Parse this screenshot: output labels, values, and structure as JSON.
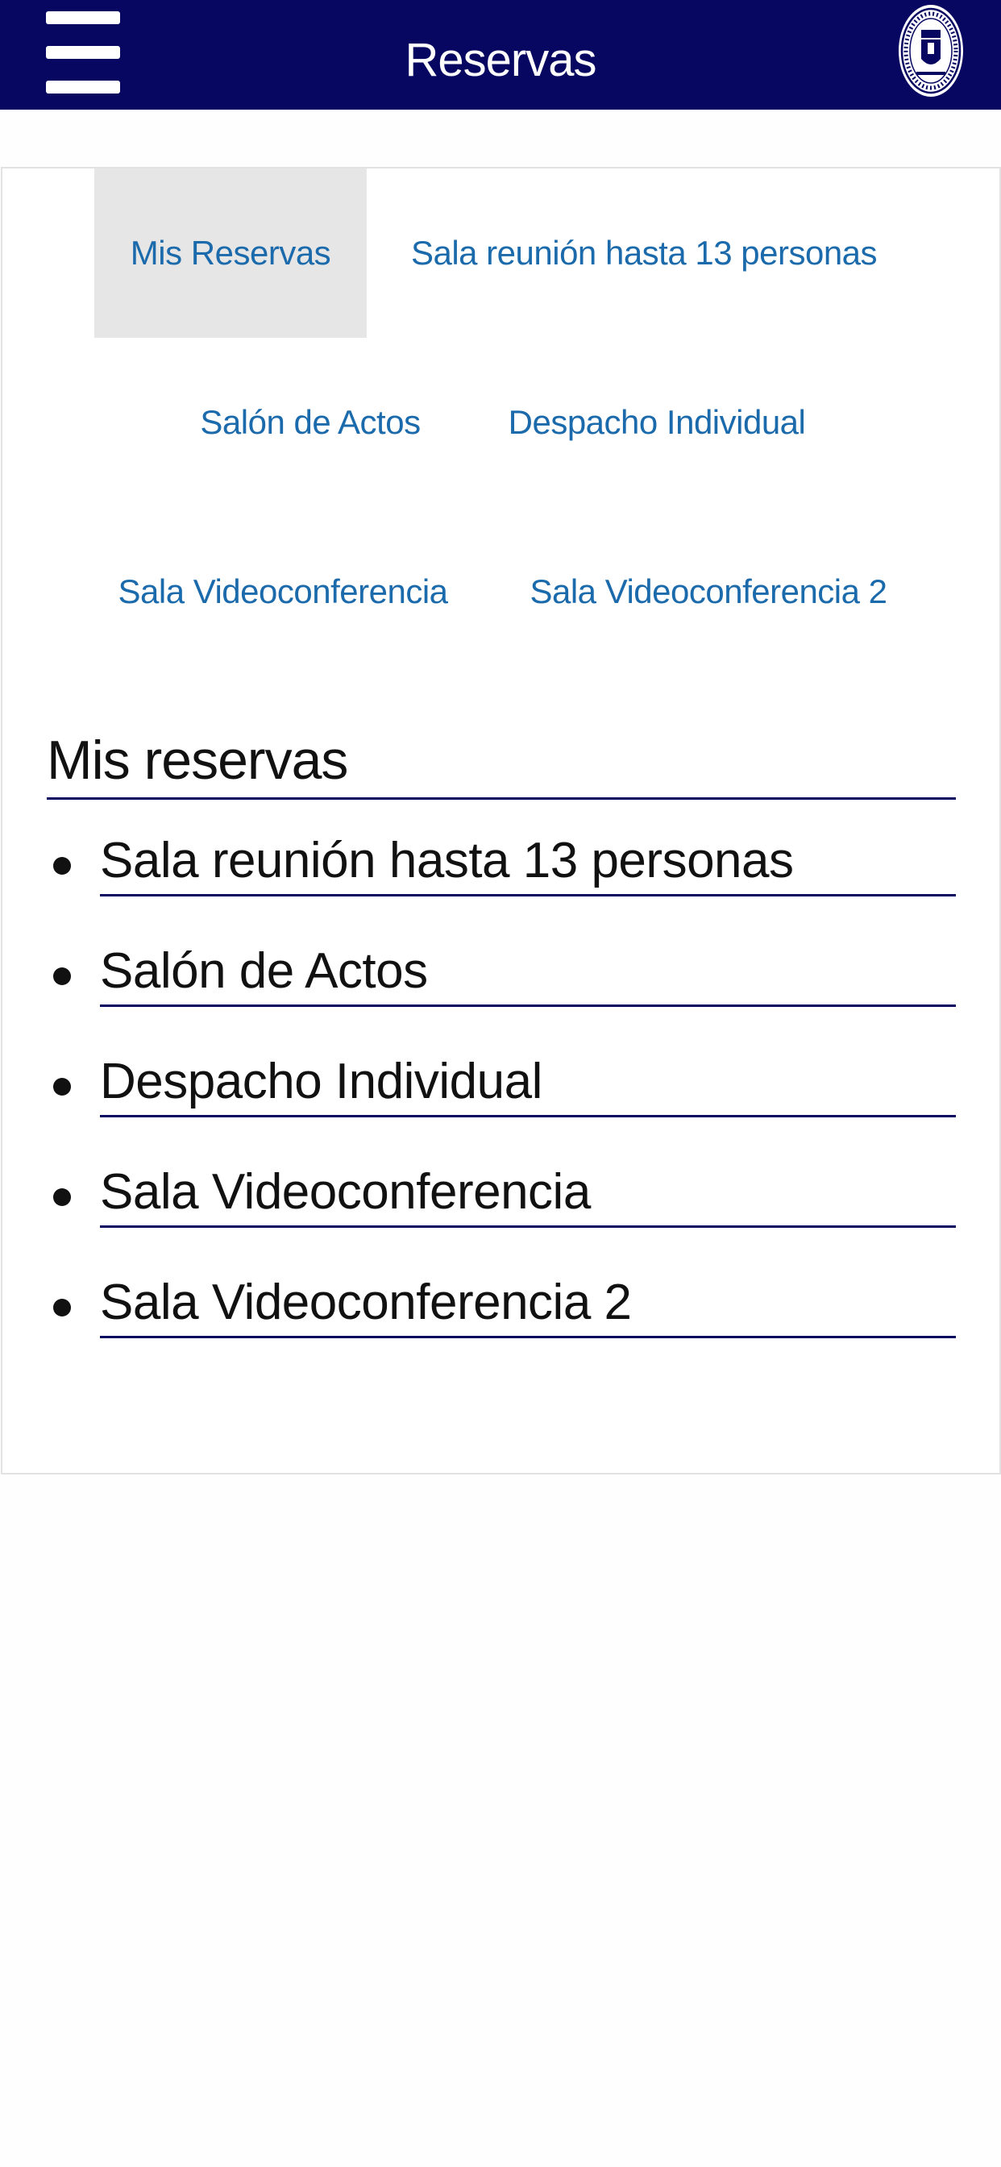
{
  "header": {
    "title": "Reservas",
    "bg_color": "#070762"
  },
  "tabs": [
    {
      "label": "Mis Reservas",
      "active": true
    },
    {
      "label": "Sala reunión hasta 13 personas",
      "active": false
    },
    {
      "label": "Salón de Actos",
      "active": false
    },
    {
      "label": "Despacho Individual",
      "active": false
    },
    {
      "label": "Sala Videoconferencia",
      "active": false
    },
    {
      "label": "Sala Videoconferencia 2",
      "active": false
    }
  ],
  "section": {
    "title": "Mis reservas",
    "items": [
      {
        "label": "Sala reunión hasta 13 personas"
      },
      {
        "label": "Salón de Actos"
      },
      {
        "label": "Despacho Individual"
      },
      {
        "label": "Sala Videoconferencia"
      },
      {
        "label": "Sala Videoconferencia 2"
      }
    ]
  },
  "colors": {
    "tab_link": "#1b6aab",
    "active_tab_bg": "#e6e6e6",
    "underline": "#070762"
  },
  "icons": {
    "menu": "hamburger-menu-icon",
    "logo": "bar-association-seal-icon"
  }
}
